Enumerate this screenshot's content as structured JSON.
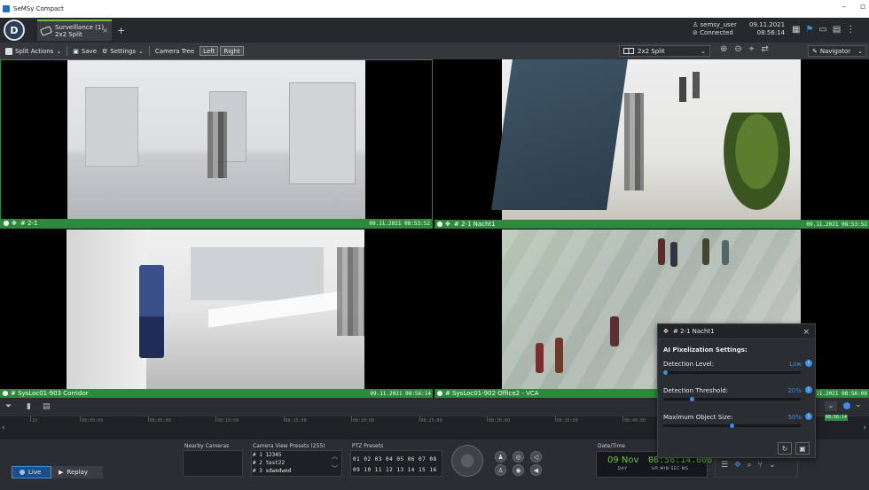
{
  "window": {
    "title": "SeMSy Compact",
    "minimize": "–",
    "restore": "▫"
  },
  "app": {
    "logo_letter": "D"
  },
  "tab": {
    "line1": "Surveillance (1)",
    "line2": "2x2 Split",
    "close": "×",
    "add": "+"
  },
  "user": {
    "name": "semsy_user",
    "status": "Connected",
    "date": "09.11.2021",
    "time": "08:56:14"
  },
  "toolbar": {
    "split_actions": "Split Actions",
    "save": "Save",
    "settings": "Settings",
    "camera_tree": "Camera Tree",
    "left": "Left",
    "right": "Right",
    "split_layout": "2x2 Split",
    "navigator": "Navigator"
  },
  "tiles": [
    {
      "label": "# 2-1",
      "timestamp": "09.11.2021 08:53:52"
    },
    {
      "label": "# 2-1  Nacht1",
      "timestamp": "09.11.2021 08:53:52"
    },
    {
      "label": "# SysLoc01-903  Corridor",
      "timestamp": "09.11.2021 08:56:14"
    },
    {
      "label": "# SysLoc01-902  Office2 - VCA",
      "timestamp": "11.2021 08:56:08"
    }
  ],
  "ai_panel": {
    "title": "# 2-1  Nacht1",
    "close": "×",
    "section": "AI Pixelization Settings:",
    "sliders": [
      {
        "label": "Detection Level:",
        "value": "Low",
        "fraction": 0.0
      },
      {
        "label": "Detection Threshold:",
        "value": "20%",
        "fraction": 0.2
      },
      {
        "label": "Maximum Object Size:",
        "value": "50%",
        "fraction": 0.5
      }
    ]
  },
  "timeline": {
    "ticks": [
      "10",
      "08:00:00",
      "08:05:00",
      "08:10:00",
      "08:15:00",
      "08:20:00",
      "08:25:00",
      "08:30:00",
      "08:35:00",
      "08:40:00",
      "08:45:00",
      "08:50:00"
    ],
    "cursor": "08:56:14"
  },
  "bottom": {
    "live": "Live",
    "replay": "Replay",
    "nearby_cameras": "Nearby Cameras",
    "presets_title": "Camera View Presets (255)",
    "presets": [
      "# 1  12345",
      "# 2  test22",
      "# 3  sdwedwed"
    ],
    "ptz_title": "PTZ Presets",
    "ptz_row1": "01  02  03  04  05  06  07  08",
    "ptz_row2": "09  10  11  12  13  14  15  16",
    "datetime_title": "Date/Time",
    "day": "09 Nov",
    "day_label": "DAY",
    "time": "08:56:14.000",
    "time_labels": "HR   MIN   SEC   MS"
  },
  "colors": {
    "accent_green": "#2d8a3d",
    "accent_blue": "#3b8fe0",
    "time_green": "#6ac14a"
  }
}
